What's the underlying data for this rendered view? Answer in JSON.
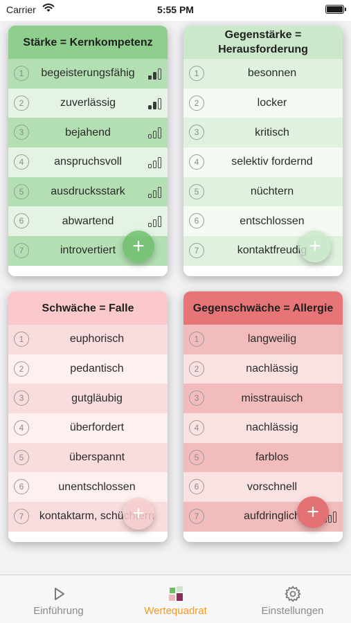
{
  "status_bar": {
    "carrier": "Carrier",
    "time": "5:55 PM"
  },
  "cards": {
    "strength": {
      "title": "Stärke = Kernkompetenz",
      "items": [
        {
          "num": "1",
          "label": "begeisterungsfähig",
          "level": 2
        },
        {
          "num": "2",
          "label": "zuverlässig",
          "level": 2
        },
        {
          "num": "3",
          "label": "bejahend",
          "level": 0
        },
        {
          "num": "4",
          "label": "anspruchsvoll",
          "level": 0
        },
        {
          "num": "5",
          "label": "ausdrucksstark",
          "level": 0
        },
        {
          "num": "6",
          "label": "abwartend",
          "level": 0
        },
        {
          "num": "7",
          "label": "introvertiert",
          "level": 0
        }
      ],
      "add_button": "+"
    },
    "counter_strength": {
      "title": "Gegenstärke = Herausforderung",
      "items": [
        {
          "num": "1",
          "label": "besonnen"
        },
        {
          "num": "2",
          "label": "locker"
        },
        {
          "num": "3",
          "label": "kritisch"
        },
        {
          "num": "4",
          "label": "selektiv fordernd"
        },
        {
          "num": "5",
          "label": "nüchtern"
        },
        {
          "num": "6",
          "label": "entschlossen"
        },
        {
          "num": "7",
          "label": "kontaktfreudig"
        }
      ],
      "add_button": "+"
    },
    "weakness": {
      "title": "Schwäche = Falle",
      "items": [
        {
          "num": "1",
          "label": "euphorisch"
        },
        {
          "num": "2",
          "label": "pedantisch"
        },
        {
          "num": "3",
          "label": "gutgläubig"
        },
        {
          "num": "4",
          "label": "überfordert"
        },
        {
          "num": "5",
          "label": "überspannt"
        },
        {
          "num": "6",
          "label": "unentschlossen"
        },
        {
          "num": "7",
          "label": "kontaktarm, schüchtern"
        }
      ],
      "add_button": "+"
    },
    "counter_weakness": {
      "title": "Gegenschwäche = Allergie",
      "items": [
        {
          "num": "1",
          "label": "langweilig"
        },
        {
          "num": "2",
          "label": "nachlässig"
        },
        {
          "num": "3",
          "label": "misstrauisch"
        },
        {
          "num": "4",
          "label": "nachlässig"
        },
        {
          "num": "5",
          "label": "farblos"
        },
        {
          "num": "6",
          "label": "vorschnell"
        },
        {
          "num": "7",
          "label": "aufdringlich"
        }
      ],
      "add_button": "+"
    }
  },
  "tab_bar": {
    "tabs": [
      {
        "label": "Einführung",
        "icon": "play-icon",
        "active": false
      },
      {
        "label": "Wertequadrat",
        "icon": "value-square-icon",
        "active": true
      },
      {
        "label": "Einstellungen",
        "icon": "gear-icon",
        "active": false
      }
    ]
  },
  "colors": {
    "accent": "#f29a1e",
    "strength": "#8ecf8e",
    "allergy": "#e77476"
  }
}
